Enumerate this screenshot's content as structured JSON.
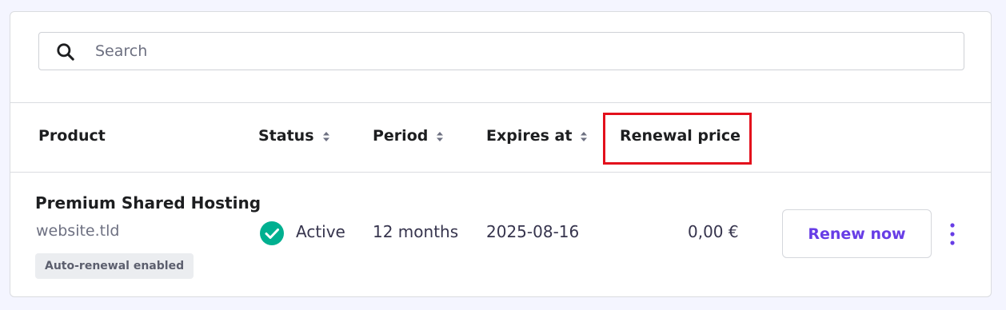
{
  "search": {
    "placeholder": "Search"
  },
  "table": {
    "headers": {
      "product": "Product",
      "status": "Status",
      "period": "Period",
      "expires": "Expires at",
      "renewal": "Renewal price"
    },
    "row": {
      "product_name": "Premium Shared Hosting",
      "domain": "website.tld",
      "badge": "Auto-renewal enabled",
      "status": "Active",
      "period": "12 months",
      "expires": "2025-08-16",
      "price": "0,00 €",
      "action": "Renew now"
    }
  },
  "colors": {
    "accent": "#673de6",
    "status_active": "#00b090",
    "highlight": "#e3101c"
  },
  "icons": [
    "search-icon",
    "sort-icon",
    "check-circle-icon",
    "more-vertical-icon"
  ]
}
